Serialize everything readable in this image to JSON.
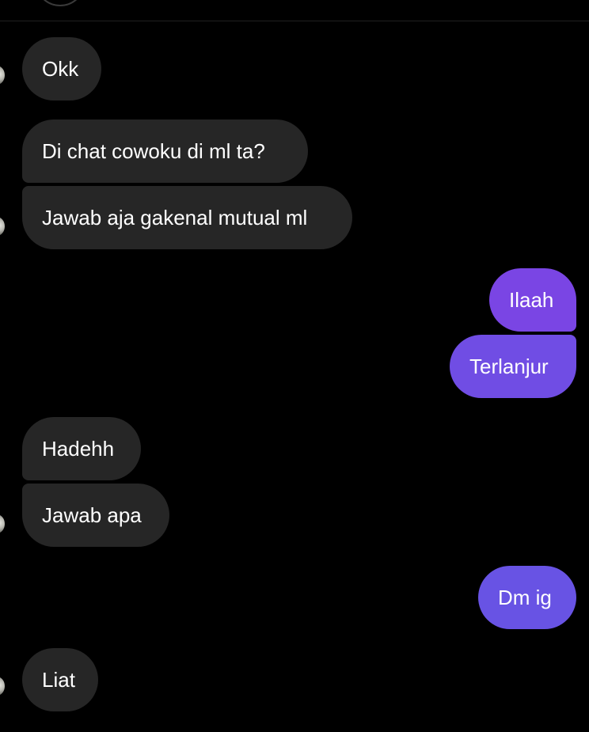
{
  "colors": {
    "background": "#000000",
    "incoming_bubble": "#262626",
    "outgoing_gradient_top": "#7a45e4",
    "outgoing_gradient_bottom": "#6853e4",
    "text": "#ffffff"
  },
  "messages": [
    {
      "direction": "incoming",
      "text": "Okk"
    },
    {
      "direction": "incoming",
      "text": "Di chat cowoku di ml ta?"
    },
    {
      "direction": "incoming",
      "text": "Jawab aja gakenal mutual ml"
    },
    {
      "direction": "outgoing",
      "text": "Ilaah"
    },
    {
      "direction": "outgoing",
      "text": "Terlanjur"
    },
    {
      "direction": "incoming",
      "text": "Hadehh"
    },
    {
      "direction": "incoming",
      "text": "Jawab apa"
    },
    {
      "direction": "outgoing",
      "text": "Dm ig"
    },
    {
      "direction": "incoming",
      "text": "Liat"
    }
  ]
}
